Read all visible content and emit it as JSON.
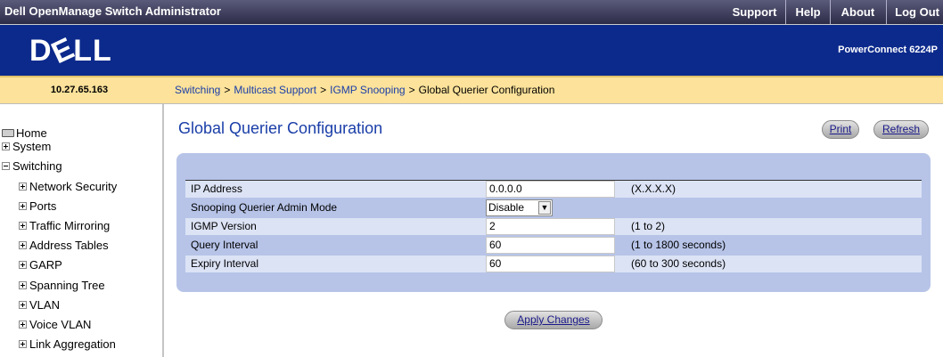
{
  "app_title": "Dell OpenManage Switch Administrator",
  "top_nav": [
    {
      "label": "Support"
    },
    {
      "label": "Help"
    },
    {
      "label": "About"
    },
    {
      "label": "Log Out"
    }
  ],
  "brand": {
    "logo_text": "DELL",
    "model": "PowerConnect 6224P"
  },
  "ip_address": "10.27.65.163",
  "breadcrumb": {
    "items": [
      "Switching",
      "Multicast Support",
      "IGMP Snooping"
    ],
    "current": "Global Querier Configuration",
    "separator": ">"
  },
  "sidebar": {
    "items": [
      {
        "label": "Home",
        "icon": "home-icon"
      },
      {
        "label": "System",
        "icon": "plus-icon"
      },
      {
        "label": "Switching",
        "icon": "minus-icon"
      },
      {
        "label": "Network Security",
        "icon": "plus-icon"
      },
      {
        "label": "Ports",
        "icon": "plus-icon"
      },
      {
        "label": "Traffic Mirroring",
        "icon": "plus-icon"
      },
      {
        "label": "Address Tables",
        "icon": "plus-icon"
      },
      {
        "label": "GARP",
        "icon": "plus-icon"
      },
      {
        "label": "Spanning Tree",
        "icon": "plus-icon"
      },
      {
        "label": "VLAN",
        "icon": "plus-icon"
      },
      {
        "label": "Voice VLAN",
        "icon": "plus-icon"
      },
      {
        "label": "Link Aggregation",
        "icon": "plus-icon"
      }
    ]
  },
  "page": {
    "title": "Global Querier Configuration",
    "print_label": "Print",
    "refresh_label": "Refresh",
    "apply_label": "Apply Changes"
  },
  "form": {
    "rows": [
      {
        "label": "IP Address",
        "value": "0.0.0.0",
        "hint": "(X.X.X.X)"
      },
      {
        "label": "Snooping Querier Admin Mode",
        "value": "Disable",
        "hint": ""
      },
      {
        "label": "IGMP Version",
        "value": "2",
        "hint": "(1 to 2)"
      },
      {
        "label": "Query Interval",
        "value": "60",
        "hint": "(1 to 1800 seconds)"
      },
      {
        "label": "Expiry Interval",
        "value": "60",
        "hint": "(60 to 300 seconds)"
      }
    ]
  },
  "colors": {
    "banner": "#0c2a8c",
    "address_bar": "#fce29a",
    "panel": "#b7c4e8",
    "row_light": "#dce3f5",
    "link": "#1a3ea8"
  }
}
